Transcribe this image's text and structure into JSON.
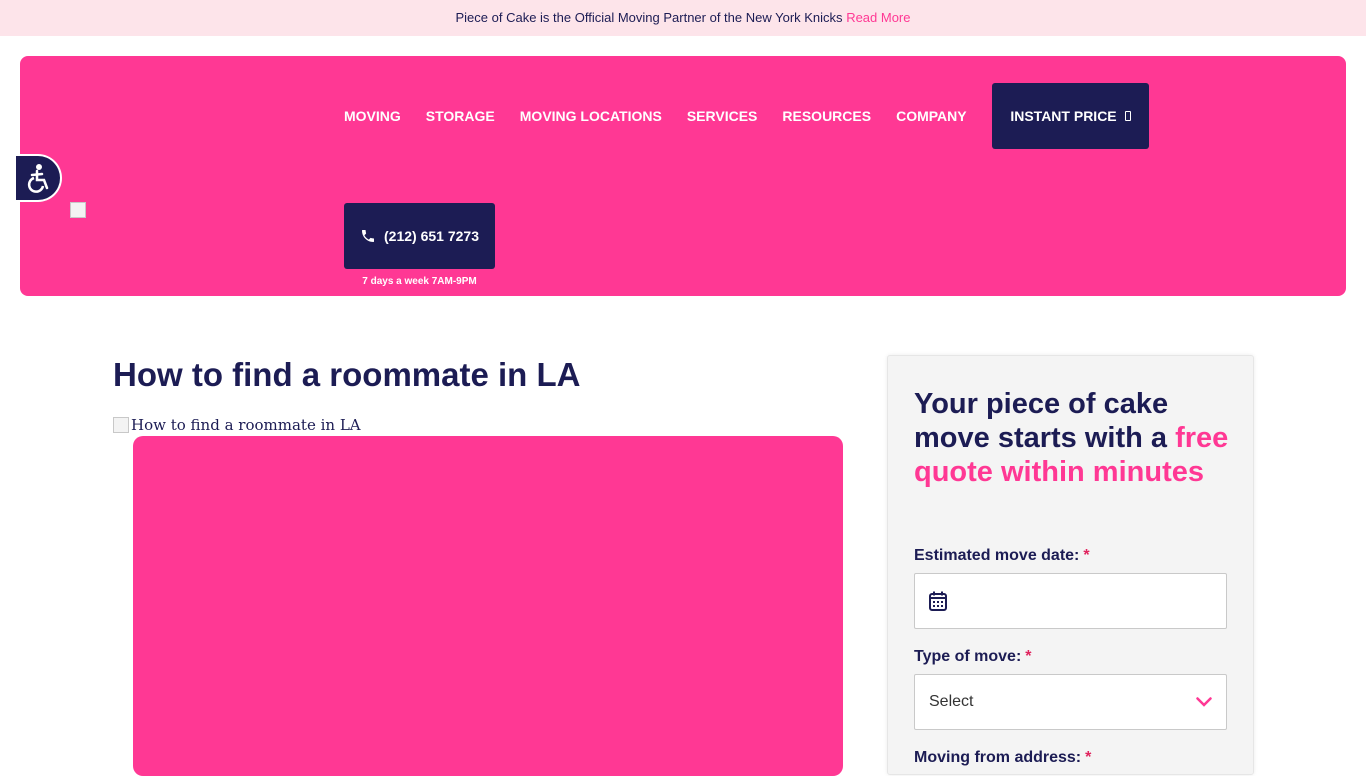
{
  "announcement": {
    "text": "Piece of Cake is the Official Moving Partner of the New York Knicks",
    "link": "Read More"
  },
  "nav": {
    "items": [
      {
        "label": "MOVING"
      },
      {
        "label": "STORAGE"
      },
      {
        "label": "MOVING LOCATIONS"
      },
      {
        "label": "SERVICES"
      },
      {
        "label": "RESOURCES"
      },
      {
        "label": "COMPANY"
      }
    ],
    "instant_price": "INSTANT PRICE",
    "phone": "(212) 651 7273",
    "phone_hours": "7 days a week 7AM-9PM"
  },
  "article": {
    "title": "How to find a roommate in LA",
    "image_alt": "How to find a roommate in LA"
  },
  "quote": {
    "heading_main": "Your piece of cake move starts with a",
    "heading_accent": "free quote within minutes",
    "fields": {
      "date_label": "Estimated move date:",
      "type_label": "Type of move:",
      "type_value": "Select",
      "from_label": "Moving from address:",
      "required": "*"
    }
  },
  "colors": {
    "brand_pink": "#ff3894",
    "navy": "#1c1c54",
    "announcement_bg": "#fde4ea"
  }
}
